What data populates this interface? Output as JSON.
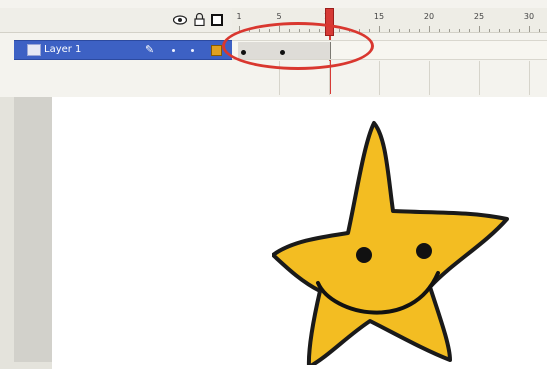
{
  "timeline": {
    "header_icons": [
      "eye-icon",
      "lock-icon",
      "outline-icon"
    ],
    "ruler": {
      "labels": [
        "1",
        "5",
        "10",
        "15",
        "20",
        "25",
        "30"
      ],
      "current_frame": "10"
    },
    "layers": [
      {
        "name": "Layer 1",
        "selected": true,
        "editing_icon": "pencil-icon",
        "keyframes": [
          "1",
          "5"
        ],
        "span_end_frame": "10"
      }
    ],
    "highlight": "frames 1-10 circled in red"
  },
  "stage": {
    "background": "#ffffff",
    "artwork": {
      "shape": "star",
      "fill": "#f3bd22",
      "stroke": "#1a1a1a",
      "face": "smiley"
    }
  },
  "colors": {
    "layer_selected": "#3d61c4",
    "playhead": "#d63a36",
    "annotation": "#d9372f"
  }
}
